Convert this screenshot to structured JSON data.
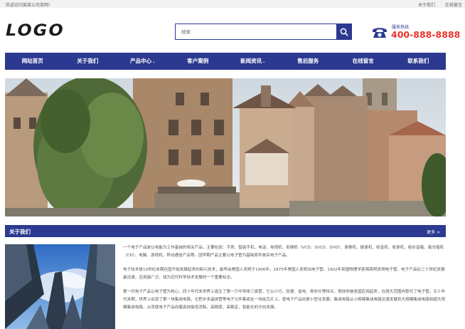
{
  "topbar": {
    "welcome": "欢迎访问某某公司官网！",
    "links": [
      "关于我们",
      "在线留言"
    ]
  },
  "header": {
    "logo_text": "LOGO",
    "search_placeholder": "搜索",
    "hotline_label": "服务热线",
    "hotline_number": "400-888-8888"
  },
  "nav": {
    "items": [
      {
        "label": "网站首页",
        "dropdown": false
      },
      {
        "label": "关于我们",
        "dropdown": false
      },
      {
        "label": "产品中心",
        "dropdown": true
      },
      {
        "label": "客户案例",
        "dropdown": false
      },
      {
        "label": "新闻资讯",
        "dropdown": true
      },
      {
        "label": "售后服务",
        "dropdown": false
      },
      {
        "label": "在线留言",
        "dropdown": false
      },
      {
        "label": "联系我们",
        "dropdown": false
      }
    ],
    "caret": "⌄"
  },
  "about": {
    "title": "关于我们",
    "more": "更多 >",
    "paragraphs": [
      "一个电子产品是以电能为工作基础的相关产品，主要包括：手表、智能手机、电话、电视机、影碟机（VCD、SVCD、DVD）、录像机、摄录机、收音机、收录机、组合音箱、激光唱机（CD）、电脑、游戏机、移动通信产品等。因早期产品主要以电子管为基础原件故名电子产品。",
      "电子技术是19世纪末期在国开始发展起来的新兴技术，最早由美国人发明于1906年，1875年美国人发明出电子管。1902年英国物理学家弗莱明发明电子管。电子产品在二十世纪发展最迅速、应用最广泛，成为近代科学技术发展的一个重要标志。",
      "第一代电子产品以电子管为核心。四十年代末世界上诞生了第一只半导体三极管，它以小巧、轻便、省电、寿命长等特点，很快地被各国应用起来，在很大范围内取代了电子管。五十年代末期，世界上出现了第一块集成电路，它把许多晶体管等电子元件集成在一块硅芯片上，使电子产品向更小型化发展。集成电路从小规模集成电路迅速发展到大规模集成电路和超大规模集成电路，从而使电子产品向着高效能低消耗、高精度、高稳定、智能化的方向发展。"
    ]
  },
  "colors": {
    "brand": "#2b3990",
    "hotline": "#e8332d"
  },
  "icons": {
    "search": "search-icon",
    "phone": "phone-icon"
  }
}
